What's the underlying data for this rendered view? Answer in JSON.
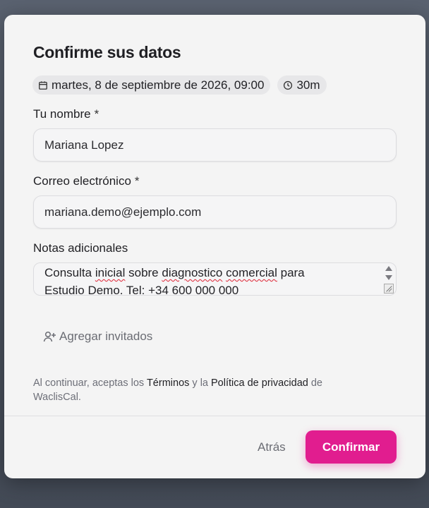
{
  "dialog": {
    "title": "Confirme sus datos",
    "date_chip": "martes, 8 de septiembre de 2026, 09:00",
    "duration_chip": "30m"
  },
  "form": {
    "name_label": "Tu nombre",
    "name_required": "*",
    "name_value": "Mariana Lopez",
    "email_label": "Correo electrónico",
    "email_required": "*",
    "email_value": "mariana.demo@ejemplo.com",
    "notes_label": "Notas adicionales",
    "notes_line1_a": "Consulta",
    "notes_line1_b": "inicial",
    "notes_line1_c": "sobre",
    "notes_line1_d": "diagnostico",
    "notes_line1_e": "comercial",
    "notes_line1_f": "para",
    "notes_line2_a": "Estudio",
    "notes_line2_b": "Demo. Tel: +34 600 000 000",
    "add_guests": "Agregar invitados"
  },
  "legal": {
    "prefix": "Al continuar, aceptas los ",
    "terms": "Términos",
    "middle": " y la ",
    "privacy": "Política de privacidad",
    "suffix": " de WaclisCal."
  },
  "footer": {
    "back_label": "Atrás",
    "confirm_label": "Confirmar"
  },
  "colors": {
    "accent": "#e11d8f",
    "modal_bg": "#f4f4f4",
    "backdrop": "#4f5763"
  },
  "icons": {
    "date": "calendar-icon",
    "duration": "clock-icon",
    "guests": "user-plus-icon"
  }
}
